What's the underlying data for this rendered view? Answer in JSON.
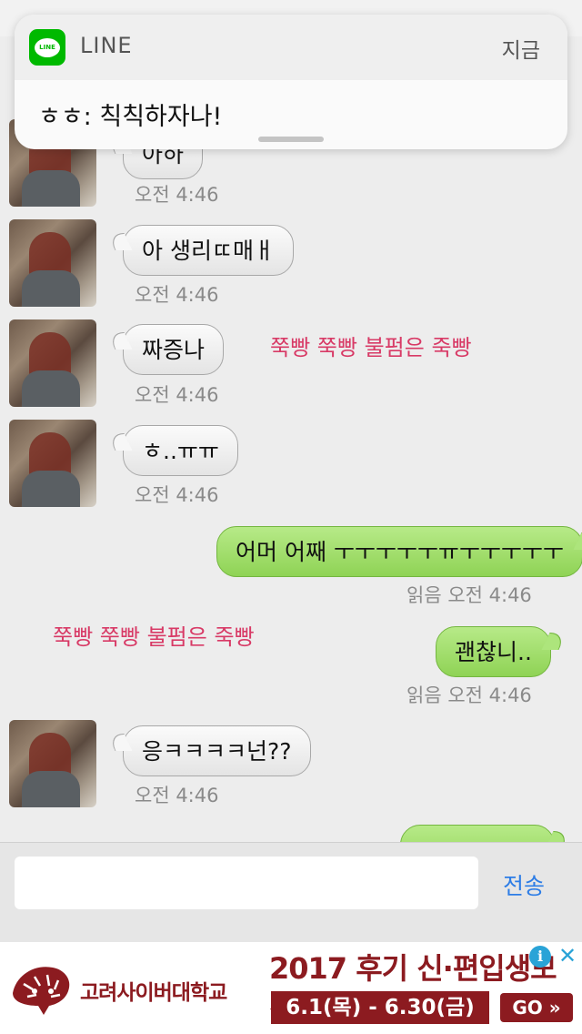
{
  "status_bar": {
    "text": ""
  },
  "notification": {
    "app_name": "LINE",
    "icon_text": "LINE",
    "time": "지금",
    "message": "ㅎㅎ: 칙칙하자나!"
  },
  "messages": [
    {
      "direction": "in",
      "text": "아하",
      "time": "오전 4:46"
    },
    {
      "direction": "in",
      "text": "아 생리ㄸ매ㅐ",
      "time": "오전 4:46"
    },
    {
      "direction": "in",
      "text": "짜증나",
      "time": "오전 4:46"
    },
    {
      "direction": "in",
      "text": "ㅎ..ㅠㅠ",
      "time": "오전 4:46"
    },
    {
      "direction": "out",
      "text": "어머 어째 ㅜㅜㅜㅜㅜㅠㅜㅜㅜㅜㅜ",
      "time": "읽음 오전 4:46"
    },
    {
      "direction": "out",
      "text": "괜찮니..",
      "time": "읽음 오전 4:46"
    },
    {
      "direction": "in",
      "text": "응ㅋㅋㅋㅋ넌??",
      "time": "오전 4:46"
    }
  ],
  "overlay_text": [
    "쭉빵 쭉빵 불펌은 죽빵",
    "쭉빵 쭉빵 불펌은 죽빵"
  ],
  "input": {
    "value": "",
    "placeholder": "",
    "send_label": "전송"
  },
  "ad": {
    "school": "고려사이버대학교",
    "headline": "2017 후기 신·편입생모집",
    "dates": "6.1(목) - 6.30(금)",
    "go": "GO »",
    "info": "i",
    "close": "✕"
  },
  "colors": {
    "outgoing_bubble": "#9bdc60",
    "incoming_bubble": "#f5f5f5",
    "chat_background": "#ededed",
    "overlay_text": "#d83a66",
    "send_button": "#2d7de6",
    "ad_brand": "#8c1b20",
    "line_green": "#00b900"
  }
}
